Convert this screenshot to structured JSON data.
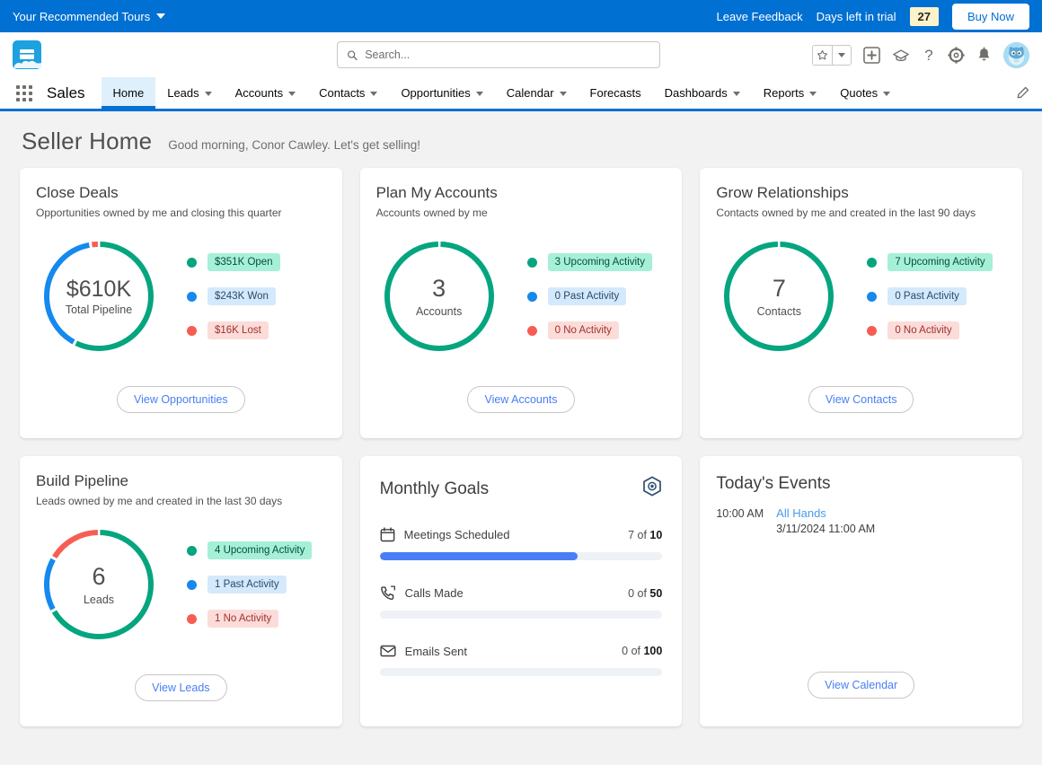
{
  "trial_bar": {
    "tours_label": "Your Recommended Tours",
    "feedback_label": "Leave Feedback",
    "days_label": "Days left in trial",
    "days_count": "27",
    "buy_now_label": "Buy Now",
    "bg_color": "#0070d2",
    "days_badge_color": "#fdf3cb"
  },
  "header": {
    "app_logo_icon": "briefcase-cloud-logo",
    "search_placeholder": "Search...",
    "search_value": "",
    "icons": [
      {
        "name": "favorites-star-icon"
      },
      {
        "name": "favorites-caret-icon"
      },
      {
        "name": "add-plus-icon"
      },
      {
        "name": "learning-hat-icon"
      },
      {
        "name": "help-question-icon"
      },
      {
        "name": "setup-gear-icon"
      },
      {
        "name": "notifications-bell-icon"
      },
      {
        "name": "user-avatar"
      }
    ]
  },
  "nav": {
    "app_name": "Sales",
    "items": [
      {
        "label": "Home",
        "has_menu": false,
        "active": true
      },
      {
        "label": "Leads",
        "has_menu": true,
        "active": false
      },
      {
        "label": "Accounts",
        "has_menu": true,
        "active": false
      },
      {
        "label": "Contacts",
        "has_menu": true,
        "active": false
      },
      {
        "label": "Opportunities",
        "has_menu": true,
        "active": false
      },
      {
        "label": "Calendar",
        "has_menu": true,
        "active": false
      },
      {
        "label": "Forecasts",
        "has_menu": false,
        "active": false
      },
      {
        "label": "Dashboards",
        "has_menu": true,
        "active": false
      },
      {
        "label": "Reports",
        "has_menu": true,
        "active": false
      },
      {
        "label": "Quotes",
        "has_menu": true,
        "active": false
      }
    ],
    "edit_icon": "pencil-icon",
    "accent_color": "#0070d2"
  },
  "page": {
    "title": "Seller Home",
    "greeting": "Good morning, Conor Cawley. Let's get selling!"
  },
  "colors": {
    "green": "#04a57f",
    "blue": "#1589ee",
    "red": "#f75d52",
    "green_pill_bg": "#a5f0d7",
    "green_pill_text": "#054e3f",
    "blue_pill_bg": "#d4e9fb",
    "blue_pill_text": "#2a4b68",
    "red_pill_bg": "#fbdcd9",
    "red_pill_text": "#a3312b",
    "progress_fill": "#4a7ef5",
    "progress_track": "#eef1f6"
  },
  "cards": {
    "close_deals": {
      "title": "Close Deals",
      "subtitle": "Opportunities owned by me and closing this quarter",
      "center_value": "$610K",
      "center_label": "Total Pipeline",
      "button_label": "View Opportunities",
      "legend": [
        {
          "label": "$351K Open",
          "color": "#04a57f",
          "style": "green"
        },
        {
          "label": "$243K Won",
          "color": "#1589ee",
          "style": "blue"
        },
        {
          "label": "$16K Lost",
          "color": "#f75d52",
          "style": "red"
        }
      ]
    },
    "plan_my_accounts": {
      "title": "Plan My Accounts",
      "subtitle": "Accounts owned by me",
      "center_value": "3",
      "center_label": "Accounts",
      "button_label": "View Accounts",
      "legend": [
        {
          "label": "3 Upcoming Activity",
          "color": "#04a57f",
          "style": "green"
        },
        {
          "label": "0 Past Activity",
          "color": "#1589ee",
          "style": "blue"
        },
        {
          "label": "0 No Activity",
          "color": "#f75d52",
          "style": "red"
        }
      ]
    },
    "grow_relationships": {
      "title": "Grow Relationships",
      "subtitle": "Contacts owned by me and created in the last 90 days",
      "center_value": "7",
      "center_label": "Contacts",
      "button_label": "View Contacts",
      "legend": [
        {
          "label": "7 Upcoming Activity",
          "color": "#04a57f",
          "style": "green"
        },
        {
          "label": "0 Past Activity",
          "color": "#1589ee",
          "style": "blue"
        },
        {
          "label": "0 No Activity",
          "color": "#f75d52",
          "style": "red"
        }
      ]
    },
    "build_pipeline": {
      "title": "Build Pipeline",
      "subtitle": "Leads owned by me and created in the last 30 days",
      "center_value": "6",
      "center_label": "Leads",
      "button_label": "View Leads",
      "legend": [
        {
          "label": "4 Upcoming Activity",
          "color": "#04a57f",
          "style": "green"
        },
        {
          "label": "1 Past Activity",
          "color": "#1589ee",
          "style": "blue"
        },
        {
          "label": "1 No Activity",
          "color": "#f75d52",
          "style": "red"
        }
      ]
    },
    "monthly_goals": {
      "title": "Monthly Goals",
      "settings_icon": "goal-settings-icon",
      "goals": [
        {
          "name": "Meetings Scheduled",
          "icon": "calendar-icon",
          "current": "7",
          "target": "10",
          "count_prefix": "7 of ",
          "count_target": "10",
          "percent": 70
        },
        {
          "name": "Calls Made",
          "icon": "phone-icon",
          "current": "0",
          "target": "50",
          "count_prefix": "0 of ",
          "count_target": "50",
          "percent": 0
        },
        {
          "name": "Emails Sent",
          "icon": "email-icon",
          "current": "0",
          "target": "100",
          "count_prefix": "0 of ",
          "count_target": "100",
          "percent": 0
        }
      ]
    },
    "todays_events": {
      "title": "Today's Events",
      "button_label": "View Calendar",
      "events": [
        {
          "time": "10:00 AM",
          "title": "All Hands",
          "datetime": "3/11/2024 11:00 AM"
        }
      ]
    }
  },
  "chart_data": [
    {
      "type": "pie",
      "title": "Close Deals",
      "subtitle": "Opportunities owned by me and closing this quarter",
      "center_total": "$610K",
      "center_label": "Total Pipeline",
      "categories": [
        "Open",
        "Won",
        "Lost"
      ],
      "values": [
        351,
        243,
        16
      ],
      "value_labels": [
        "$351K Open",
        "$243K Won",
        "$16K Lost"
      ],
      "colors": [
        "#04a57f",
        "#1589ee",
        "#f75d52"
      ],
      "legend": "right",
      "units": "thousands USD"
    },
    {
      "type": "pie",
      "title": "Plan My Accounts",
      "subtitle": "Accounts owned by me",
      "center_total": "3",
      "center_label": "Accounts",
      "categories": [
        "Upcoming Activity",
        "Past Activity",
        "No Activity"
      ],
      "values": [
        3,
        0,
        0
      ],
      "value_labels": [
        "3 Upcoming Activity",
        "0 Past Activity",
        "0 No Activity"
      ],
      "colors": [
        "#04a57f",
        "#1589ee",
        "#f75d52"
      ],
      "legend": "right"
    },
    {
      "type": "pie",
      "title": "Grow Relationships",
      "subtitle": "Contacts owned by me and created in the last 90 days",
      "center_total": "7",
      "center_label": "Contacts",
      "categories": [
        "Upcoming Activity",
        "Past Activity",
        "No Activity"
      ],
      "values": [
        7,
        0,
        0
      ],
      "value_labels": [
        "7 Upcoming Activity",
        "0 Past Activity",
        "0 No Activity"
      ],
      "colors": [
        "#04a57f",
        "#1589ee",
        "#f75d52"
      ],
      "legend": "right"
    },
    {
      "type": "pie",
      "title": "Build Pipeline",
      "subtitle": "Leads owned by me and created in the last 30 days",
      "center_total": "6",
      "center_label": "Leads",
      "categories": [
        "Upcoming Activity",
        "Past Activity",
        "No Activity"
      ],
      "values": [
        4,
        1,
        1
      ],
      "value_labels": [
        "4 Upcoming Activity",
        "1 Past Activity",
        "1 No Activity"
      ],
      "colors": [
        "#04a57f",
        "#1589ee",
        "#f75d52"
      ],
      "legend": "right"
    },
    {
      "type": "bar",
      "title": "Monthly Goals",
      "orientation": "horizontal-progress",
      "categories": [
        "Meetings Scheduled",
        "Calls Made",
        "Emails Sent"
      ],
      "values": [
        7,
        0,
        0
      ],
      "targets": [
        10,
        50,
        100
      ],
      "colors": [
        "#4a7ef5"
      ],
      "track_color": "#eef1f6"
    }
  ]
}
